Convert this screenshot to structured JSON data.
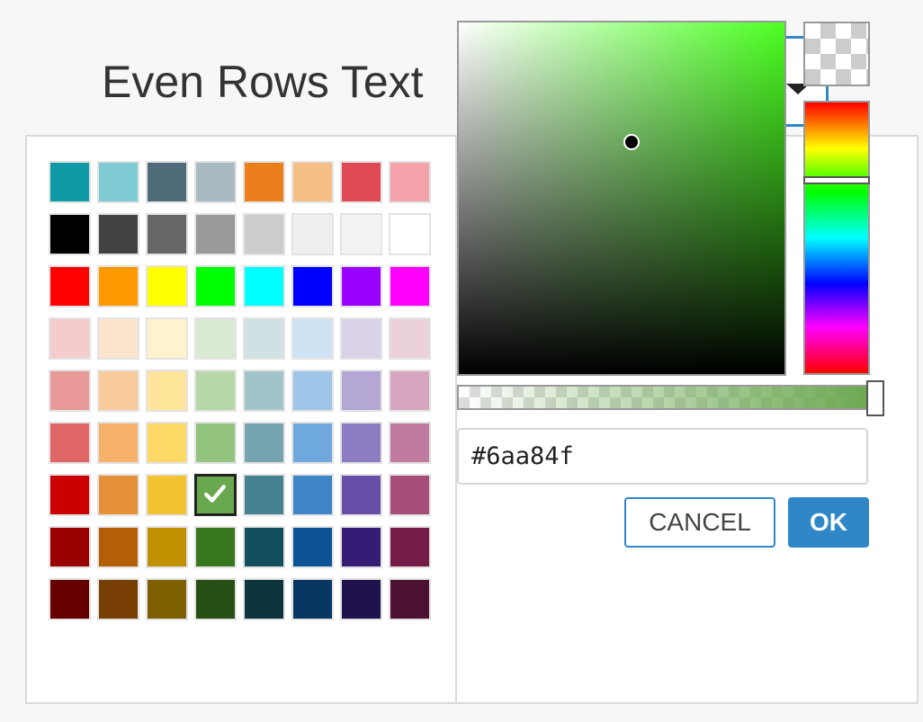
{
  "header": {
    "title": "Even Rows Text",
    "current_color": "#6aa84f"
  },
  "palette": {
    "selected_color": "#6aa84f",
    "rows": [
      [
        "#0f9aa6",
        "#7ecbd3",
        "#4f6a78",
        "#a9bac2",
        "#ea7f1c",
        "#f5bf86",
        "#e04a55",
        "#f3a2aa"
      ],
      [
        "#000000",
        "#434343",
        "#666666",
        "#999999",
        "#cccccc",
        "#efefef",
        "#f3f3f3",
        "#ffffff"
      ],
      [
        "#ff0000",
        "#ff9900",
        "#ffff00",
        "#00ff00",
        "#00ffff",
        "#0000ff",
        "#9900ff",
        "#ff00ff"
      ],
      [
        "#f4cccc",
        "#fce5cd",
        "#fff2cc",
        "#d9ead3",
        "#d0e0e3",
        "#cfe2f3",
        "#d9d2e9",
        "#ead1dc"
      ],
      [
        "#ea9999",
        "#f9cb9c",
        "#ffe599",
        "#b6d7a8",
        "#a2c4c9",
        "#9fc5e8",
        "#b4a7d6",
        "#d5a6bd"
      ],
      [
        "#e06666",
        "#f6b26b",
        "#ffd966",
        "#93c47d",
        "#76a5af",
        "#6fa8dc",
        "#8e7cc3",
        "#c27ba0"
      ],
      [
        "#cc0000",
        "#e69138",
        "#f1c232",
        "#6aa84f",
        "#45818e",
        "#3d85c6",
        "#674ea7",
        "#a64d79"
      ],
      [
        "#990000",
        "#b45f06",
        "#bf9000",
        "#38761d",
        "#134f5c",
        "#0b5394",
        "#351c75",
        "#741b47"
      ],
      [
        "#660000",
        "#783f04",
        "#7f6000",
        "#274e13",
        "#0c343d",
        "#073763",
        "#20124d",
        "#4c1130"
      ]
    ]
  },
  "picker": {
    "hue_color": "#4cff22",
    "saturation_pct": 53,
    "value_pct": 66,
    "hue_pct": 29,
    "alpha_pct": 100,
    "hex_value": "#6aa84f"
  },
  "icons": {
    "dropdown": "caret-down-icon",
    "selected_marker": "checkmark-icon",
    "transparent": "checkerboard-icon"
  },
  "buttons": {
    "cancel_label": "CANCEL",
    "ok_label": "OK"
  }
}
